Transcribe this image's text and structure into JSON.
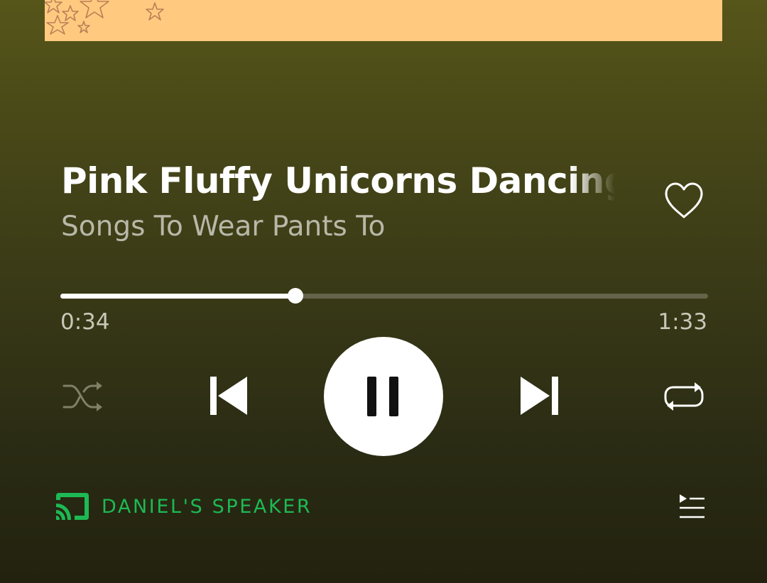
{
  "track": {
    "title": "Pink Fluffy Unicorns Dancing",
    "subtitle": "Songs To Wear Pants To"
  },
  "playback": {
    "elapsed": "0:34",
    "total": "1:33",
    "progress_fraction": 0.363,
    "state": "playing"
  },
  "device": {
    "label": "DANIEL'S SPEAKER",
    "icon": "cast-connected-icon"
  },
  "icons": {
    "like": "heart-outline-icon",
    "shuffle": "shuffle-icon",
    "previous": "skip-previous-icon",
    "pause": "pause-icon",
    "next": "skip-next-icon",
    "repeat": "repeat-icon",
    "queue": "queue-icon"
  },
  "colors": {
    "accent": "#1db954",
    "album_art": "#ffca80",
    "background_top": "#56561a",
    "background_bottom": "#22220f"
  }
}
